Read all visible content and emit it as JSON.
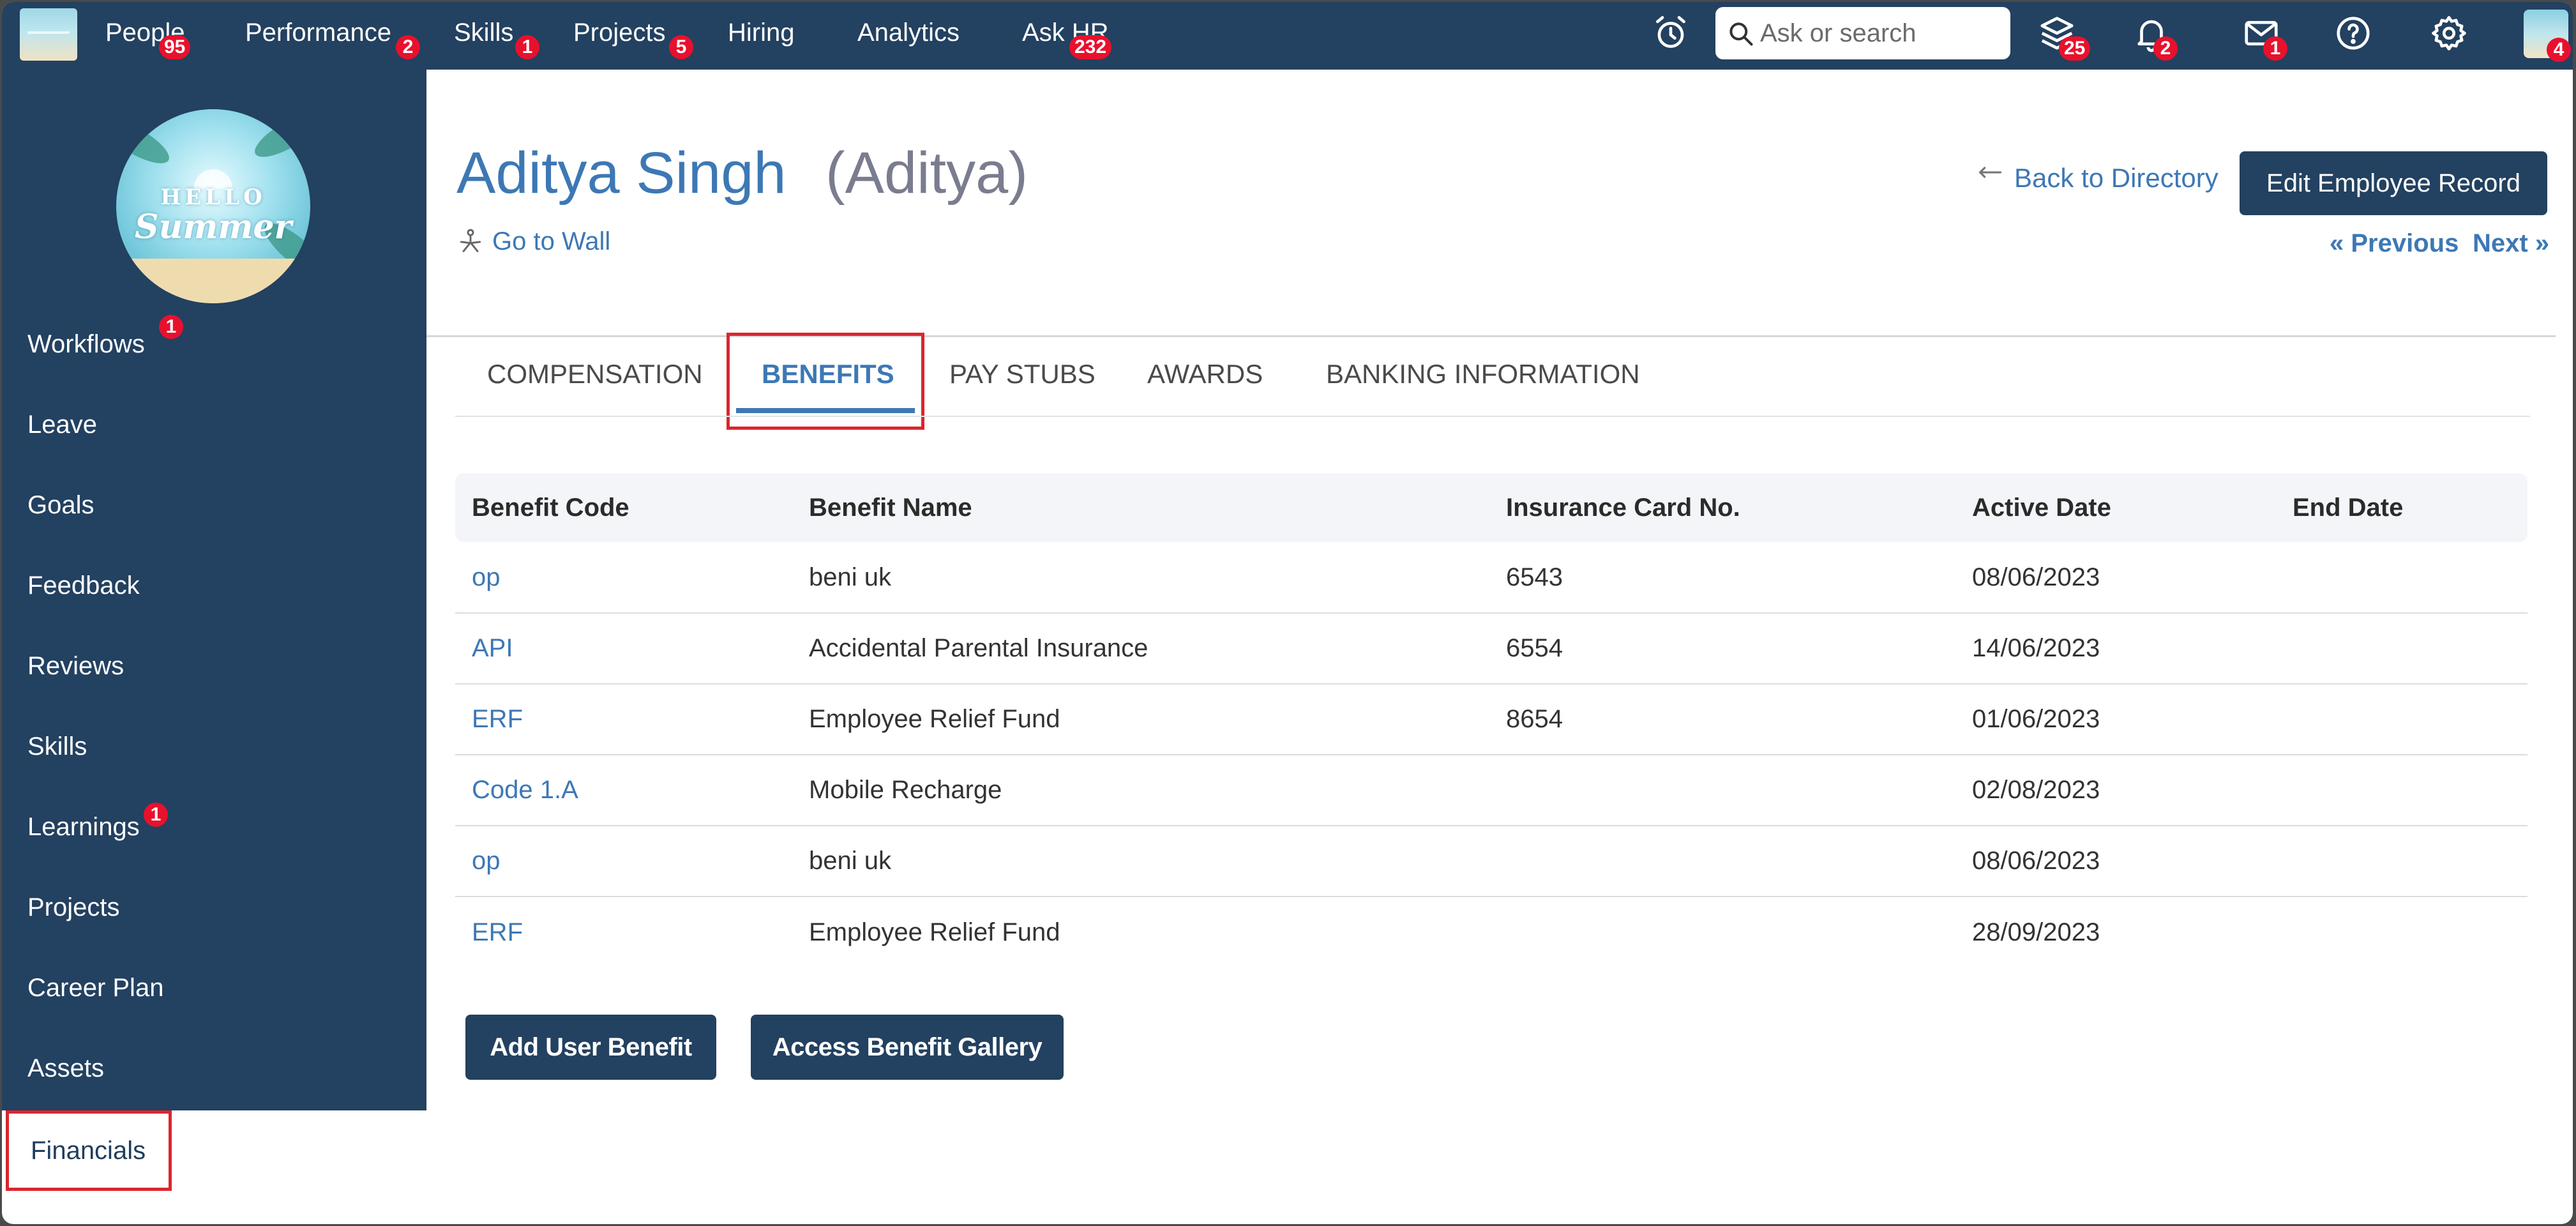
{
  "topnav": {
    "items": [
      {
        "label": "People",
        "badge": "95"
      },
      {
        "label": "Performance",
        "badge": "2"
      },
      {
        "label": "Skills",
        "badge": "1"
      },
      {
        "label": "Projects",
        "badge": "5"
      },
      {
        "label": "Hiring",
        "badge": ""
      },
      {
        "label": "Analytics",
        "badge": ""
      },
      {
        "label": "Ask HR",
        "badge": "232"
      }
    ],
    "search_placeholder": "Ask or search",
    "icons": {
      "alarm": {
        "name": "alarm-clock-icon",
        "badge": ""
      },
      "learning": {
        "name": "layers-icon",
        "badge": "25"
      },
      "notifications": {
        "name": "bell-icon",
        "badge": "2"
      },
      "messages": {
        "name": "mail-icon",
        "badge": "1"
      },
      "help": {
        "name": "help-icon",
        "badge": ""
      },
      "settings": {
        "name": "gear-icon",
        "badge": ""
      },
      "avatar": {
        "name": "user-avatar",
        "badge": "4"
      }
    }
  },
  "sidebar": {
    "items": [
      {
        "label": "Workflows",
        "badge": "1"
      },
      {
        "label": "Leave",
        "badge": ""
      },
      {
        "label": "Goals",
        "badge": ""
      },
      {
        "label": "Feedback",
        "badge": ""
      },
      {
        "label": "Reviews",
        "badge": ""
      },
      {
        "label": "Skills",
        "badge": ""
      },
      {
        "label": "Learnings",
        "badge": "1"
      },
      {
        "label": "Projects",
        "badge": ""
      },
      {
        "label": "Career Plan",
        "badge": ""
      },
      {
        "label": "Assets",
        "badge": ""
      }
    ],
    "active": {
      "label": "Financials"
    },
    "photo": {
      "line1": "HELLO",
      "line2": "Summer"
    }
  },
  "employee": {
    "name": "Aditya Singh",
    "nickname": "(Aditya)",
    "go_to_wall": "Go to Wall"
  },
  "header_actions": {
    "back": "Back to Directory",
    "edit": "Edit Employee Record",
    "prev": "« Previous",
    "next": "Next »"
  },
  "tabs": [
    "COMPENSATION",
    "BENEFITS",
    "PAY STUBS",
    "AWARDS",
    "BANKING INFORMATION"
  ],
  "active_tab": "BENEFITS",
  "table": {
    "columns": [
      "Benefit Code",
      "Benefit Name",
      "Insurance Card No.",
      "Active Date",
      "End Date"
    ],
    "rows": [
      [
        "op",
        "beni uk",
        "6543",
        "08/06/2023",
        ""
      ],
      [
        "API",
        "Accidental Parental Insurance",
        "6554",
        "14/06/2023",
        ""
      ],
      [
        "ERF",
        "Employee Relief Fund",
        "8654",
        "01/06/2023",
        ""
      ],
      [
        "Code 1.A",
        "Mobile Recharge",
        "",
        "02/08/2023",
        ""
      ],
      [
        "op",
        "beni uk",
        "",
        "08/06/2023",
        ""
      ],
      [
        "ERF",
        "Employee Relief Fund",
        "",
        "28/09/2023",
        ""
      ]
    ]
  },
  "buttons": {
    "add": "Add User Benefit",
    "gallery": "Access Benefit Gallery"
  },
  "colors": {
    "navy": "#234160",
    "link_blue": "#3d78b5",
    "badge_red": "#e8112d",
    "highlight_red": "#d9262f"
  }
}
